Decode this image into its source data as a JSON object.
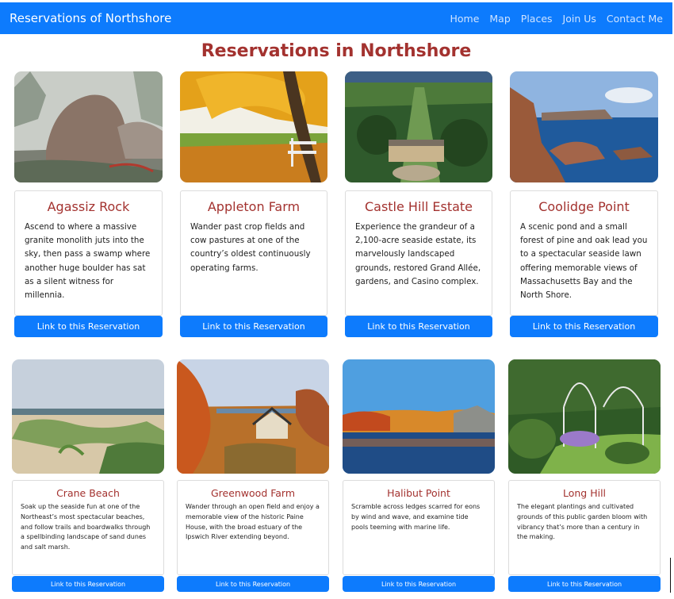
{
  "navbar": {
    "brand": "Reservations of Northshore",
    "links": [
      "Home",
      "Map",
      "Places",
      "Join Us",
      "Contact Me"
    ]
  },
  "page_title": "Reservations in Northshore",
  "cards": [
    {
      "title": "Agassiz Rock",
      "text": "Ascend to where a massive granite monolith juts into the sky, then pass a swamp where another huge boulder has sat as a silent witness for millennia.",
      "button": "Link to this Reservation"
    },
    {
      "title": "Appleton Farm",
      "text": "Wander past crop fields and cow pastures at one of the country’s oldest continuously operating farms.",
      "button": "Link to this Reservation"
    },
    {
      "title": "Castle Hill Estate",
      "text": "Experience the grandeur of a 2,100-acre seaside estate, its marvelously landscaped grounds, restored Grand Allée, gardens, and Casino complex.",
      "button": "Link to this Reservation"
    },
    {
      "title": "Coolidge Point",
      "text": "A scenic pond and a small forest of pine and oak lead you to a spectacular seaside lawn offering memorable views of Massachusetts Bay and the North Shore.",
      "button": "Link to this Reservation"
    },
    {
      "title": "Crane Beach",
      "text": "Soak up the seaside fun at one of the Northeast’s most spectacular beaches, and follow trails and boardwalks through a spellbinding landscape of sand dunes and salt marsh.",
      "button": "Link to this Reservation"
    },
    {
      "title": "Greenwood Farm",
      "text": "Wander through an open field and enjoy a memorable view of the historic Paine House, with the broad estuary of the Ipswich River extending beyond.",
      "button": "Link to this Reservation"
    },
    {
      "title": "Halibut Point",
      "text": "Scramble across ledges scarred for eons by wind and wave, and examine tide pools teeming with marine life.",
      "button": "Link to this Reservation"
    },
    {
      "title": "Long Hill",
      "text": "The elegant plantings and cultivated grounds of this public garden bloom with vibrancy that’s more than a century in the making.",
      "button": "Link to this Reservation"
    }
  ]
}
